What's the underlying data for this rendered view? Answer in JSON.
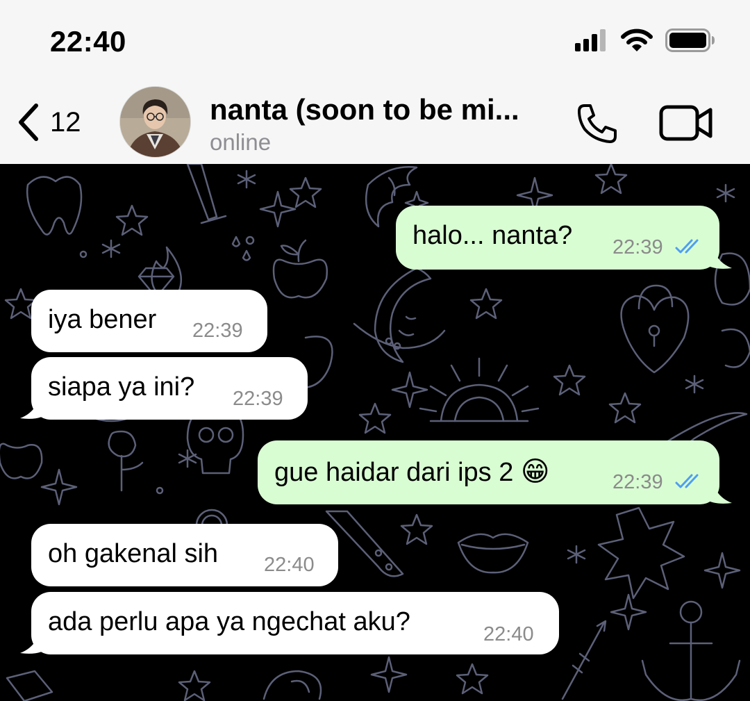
{
  "status_bar": {
    "time": "22:40",
    "icons": [
      "signal-icon",
      "wifi-icon",
      "battery-icon"
    ]
  },
  "header": {
    "back_count": "12",
    "contact_name": "nanta (soon to be mi...",
    "contact_status": "online",
    "actions": [
      "phone-icon",
      "video-camera-icon"
    ]
  },
  "messages": [
    {
      "direction": "outgoing",
      "text": "halo... nanta?",
      "time": "22:39",
      "read": true
    },
    {
      "direction": "incoming",
      "text": "iya bener",
      "time": "22:39"
    },
    {
      "direction": "incoming",
      "text": "siapa ya ini?",
      "time": "22:39"
    },
    {
      "direction": "outgoing",
      "text": "gue haidar dari ips 2",
      "emoji": "😁",
      "time": "22:39",
      "read": true
    },
    {
      "direction": "incoming",
      "text": "oh gakenal sih",
      "time": "22:40"
    },
    {
      "direction": "incoming",
      "text": "ada perlu apa ya ngechat aku?",
      "time": "22:40"
    }
  ],
  "colors": {
    "header_bg": "#f6f6f6",
    "chat_bg": "#000000",
    "outgoing_bubble": "#d9fdd3",
    "incoming_bubble": "#ffffff",
    "read_tick": "#4f9ef2",
    "wallpaper_line": "#5c6078"
  }
}
